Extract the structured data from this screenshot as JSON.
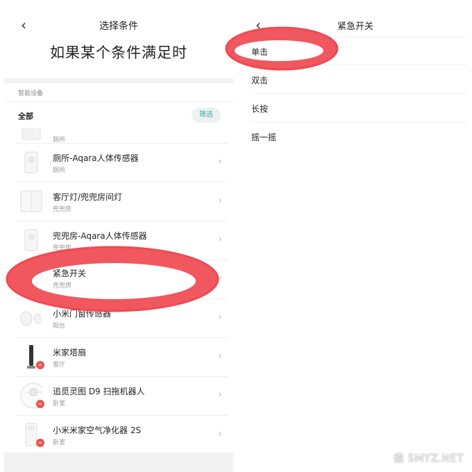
{
  "left": {
    "header_title": "选择条件",
    "big_title": "如果某个条件满足时",
    "section_label": "智能设备",
    "all_label": "全部",
    "filter_label": "筛选",
    "devices": [
      {
        "name": "",
        "room": "厕所",
        "icon": "sensor-icon"
      },
      {
        "name": "厕所-Aqara人体传感器",
        "room": "厕所",
        "icon": "motion-sensor-icon"
      },
      {
        "name": "客厅灯/兜兜房间灯",
        "room": "兜兜房",
        "icon": "wall-switch-icon"
      },
      {
        "name": "兜兜房-Aqara人体传感器",
        "room": "兜兜房",
        "icon": "motion-sensor-icon"
      },
      {
        "name": "紧急开关",
        "room": "兜兜房",
        "icon": "button-icon"
      },
      {
        "name": "小米门窗传感器",
        "room": "阳台",
        "icon": "door-sensor-icon"
      },
      {
        "name": "米家塔扇",
        "room": "客厅",
        "icon": "tower-fan-icon"
      },
      {
        "name": "追觅灵图 D9 扫拖机器人",
        "room": "卧室",
        "icon": "robot-vacuum-icon"
      },
      {
        "name": "小米米家空气净化器 2S",
        "room": "卧室",
        "icon": "air-purifier-icon"
      }
    ]
  },
  "right": {
    "title": "紧急开关",
    "options": [
      "单击",
      "双击",
      "长按",
      "摇一摇"
    ]
  },
  "colors": {
    "accent": "#4aa398",
    "annotation": "#ef4a52",
    "badge": "#e8574b"
  },
  "watermark": "值 SMYZ.NET"
}
